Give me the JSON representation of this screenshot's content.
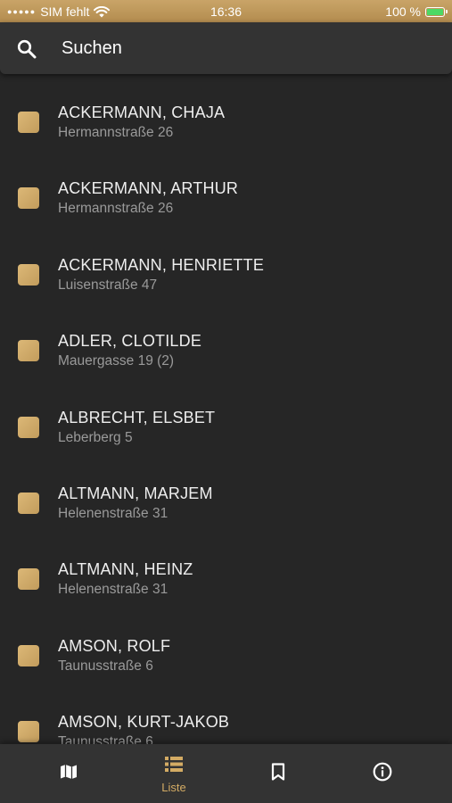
{
  "status_bar": {
    "carrier": "SIM fehlt",
    "time": "16:36",
    "battery": "100 %"
  },
  "search": {
    "placeholder": "Suchen",
    "icon": "search-icon"
  },
  "list": {
    "items": [
      {
        "name": "ACKERMANN, CHAJA",
        "address": "Hermannstraße 26"
      },
      {
        "name": "ACKERMANN, ARTHUR",
        "address": "Hermannstraße 26"
      },
      {
        "name": "ACKERMANN, HENRIETTE",
        "address": "Luisenstraße 47"
      },
      {
        "name": "ADLER, CLOTILDE",
        "address": "Mauergasse 19 (2)"
      },
      {
        "name": "ALBRECHT, ELSBET",
        "address": "Leberberg 5"
      },
      {
        "name": "ALTMANN, MARJEM",
        "address": "Helenenstraße 31"
      },
      {
        "name": "ALTMANN, HEINZ",
        "address": "Helenenstraße 31"
      },
      {
        "name": "AMSON, ROLF",
        "address": "Taunusstraße 6"
      },
      {
        "name": "AMSON, KURT-JAKOB",
        "address": "Taunusstraße 6"
      }
    ]
  },
  "tabs": [
    {
      "id": "map",
      "icon": "map-icon",
      "label": ""
    },
    {
      "id": "list",
      "icon": "list-icon",
      "label": "Liste",
      "active": true
    },
    {
      "id": "bookmarks",
      "icon": "bookmark-icon",
      "label": ""
    },
    {
      "id": "info",
      "icon": "info-icon",
      "label": ""
    }
  ],
  "colors": {
    "accent": "#d3ab64",
    "background": "#262626",
    "bar": "#333333",
    "status_bar": "#c0995c"
  }
}
